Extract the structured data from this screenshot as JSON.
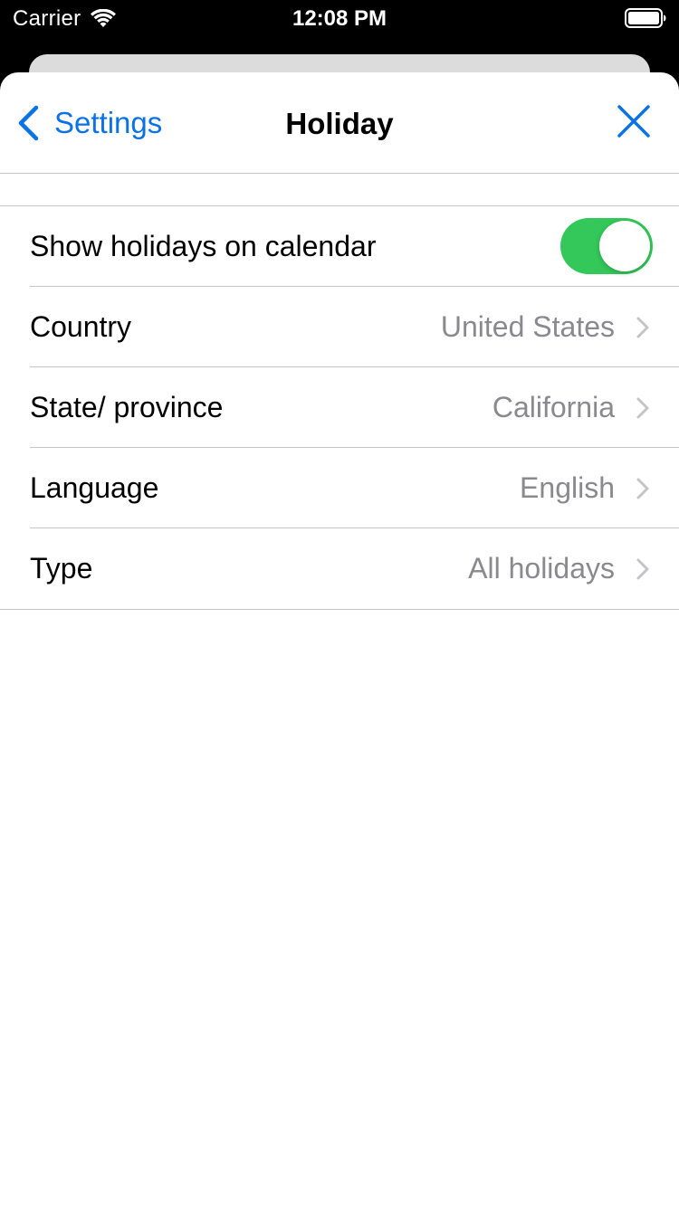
{
  "status_bar": {
    "carrier": "Carrier",
    "time": "12:08 PM",
    "wifi_icon": "wifi-icon",
    "battery_icon": "battery-full-icon"
  },
  "nav": {
    "back_label": "Settings",
    "title": "Holiday",
    "back_icon": "chevron-left-icon",
    "close_icon": "close-icon",
    "accent_color": "#0a72e8"
  },
  "settings": {
    "show_holidays": {
      "label": "Show holidays on calendar",
      "enabled": true,
      "toggle_color": "#34c759"
    },
    "rows": [
      {
        "label": "Country",
        "value": "United States"
      },
      {
        "label": "State/ province",
        "value": "California"
      },
      {
        "label": "Language",
        "value": "English"
      },
      {
        "label": "Type",
        "value": "All holidays"
      }
    ]
  }
}
